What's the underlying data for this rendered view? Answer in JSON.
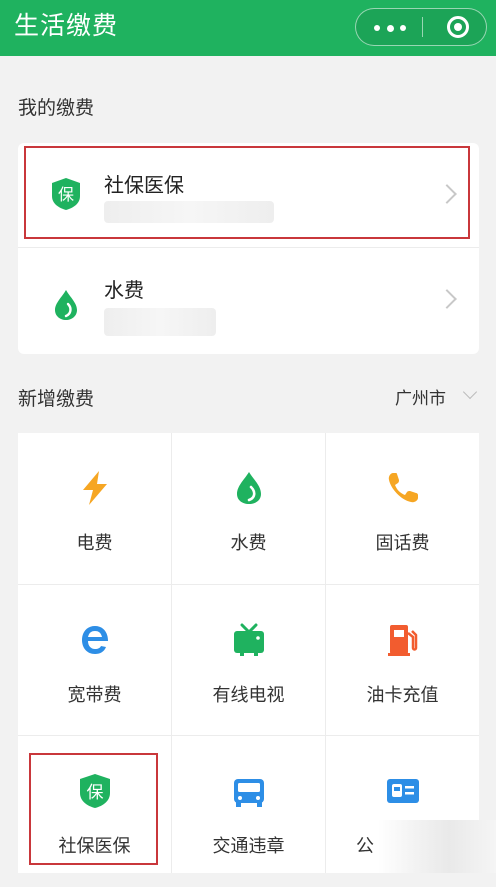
{
  "header": {
    "title": "生活缴费",
    "more_icon": "more-dots-icon",
    "close_icon": "target-icon",
    "color": "#1fb25f"
  },
  "my_payments": {
    "title": "我的缴费",
    "items": [
      {
        "name": "社保医保",
        "icon": "shield-bao-icon"
      },
      {
        "name": "水费",
        "icon": "water-drop-icon"
      }
    ]
  },
  "new_payments": {
    "title": "新增缴费",
    "city": "广州市",
    "items": [
      {
        "label": "电费",
        "icon": "lightning-icon"
      },
      {
        "label": "水费",
        "icon": "water-drop-icon"
      },
      {
        "label": "固话费",
        "icon": "phone-icon"
      },
      {
        "label": "宽带费",
        "icon": "broadband-e-icon"
      },
      {
        "label": "有线电视",
        "icon": "tv-icon"
      },
      {
        "label": "油卡充值",
        "icon": "fuel-pump-icon"
      },
      {
        "label": "社保医保",
        "icon": "shield-bao-icon"
      },
      {
        "label": "交通违章",
        "icon": "car-icon"
      },
      {
        "label": "公",
        "icon": "bus-card-icon"
      }
    ]
  },
  "colors": {
    "brand_green": "#1fb25f",
    "orange": "#f6a623",
    "blue": "#2d8ee6",
    "red_orange": "#f25c2f",
    "highlight_red": "#c9373b"
  }
}
